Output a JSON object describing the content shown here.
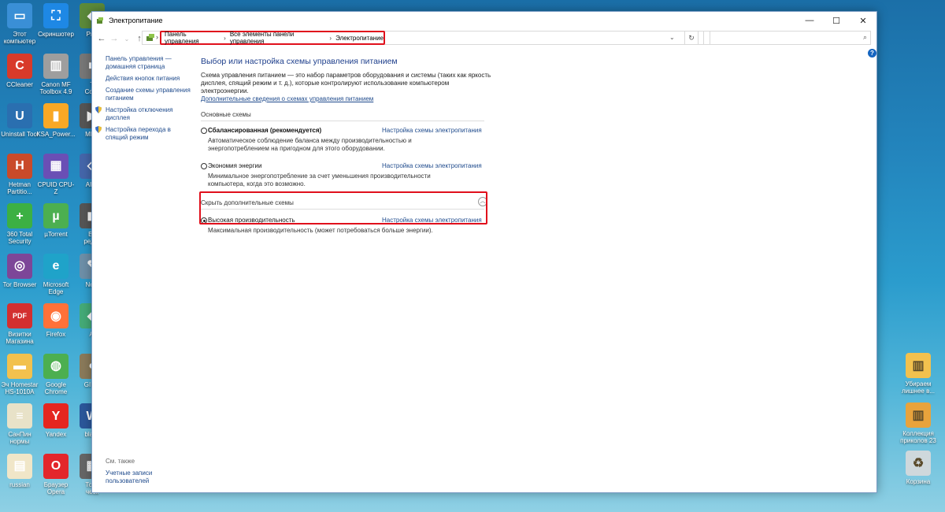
{
  "desktop": {
    "left_icons": [
      {
        "label": "Этот\nкомпьютер",
        "icon": "computer-icon",
        "color": "#3a8fd6",
        "glyph": "▭"
      },
      {
        "label": "CCleaner",
        "icon": "ccleaner-icon",
        "color": "#d83a2a",
        "glyph": "C"
      },
      {
        "label": "Uninstall Tool",
        "icon": "uninstall-tool-icon",
        "color": "#2a6fb0",
        "glyph": "U"
      },
      {
        "label": "Hetman\nPartitio...",
        "icon": "hetman-icon",
        "color": "#c94a2a",
        "glyph": "H"
      },
      {
        "label": "360 Total\nSecurity",
        "icon": "360-security-icon",
        "color": "#3cb043",
        "glyph": "+"
      },
      {
        "label": "Tor Browser",
        "icon": "tor-icon",
        "color": "#7d4698",
        "glyph": "◎"
      },
      {
        "label": "Визитки\nМагазина",
        "icon": "pdf-icon",
        "color": "#d32f2f",
        "glyph": "PDF"
      },
      {
        "label": "Эч Homestar\nHS-1010A",
        "icon": "folder-icon",
        "color": "#f2c14e",
        "glyph": "▬"
      },
      {
        "label": "СанПин\nнормы",
        "icon": "document-icon",
        "color": "#e8e2c8",
        "glyph": "≡"
      },
      {
        "label": "russian",
        "icon": "file-icon",
        "color": "#f0e6c8",
        "glyph": "▤"
      }
    ],
    "second_icons": [
      {
        "label": "Скриншотер",
        "icon": "screenshoter-icon",
        "color": "#1e88e5",
        "glyph": "⛶"
      },
      {
        "label": "Canon MF\nToolbox 4.9",
        "icon": "canon-icon",
        "color": "#9e9e9e",
        "glyph": "▥"
      },
      {
        "label": "KSA_Power...",
        "icon": "ksa-icon",
        "color": "#f9a825",
        "glyph": "▮"
      },
      {
        "label": "CPUID CPU-Z",
        "icon": "cpuz-icon",
        "color": "#6a4fb5",
        "glyph": "▦"
      },
      {
        "label": "µTorrent",
        "icon": "utorrent-icon",
        "color": "#4caf50",
        "glyph": "µ"
      },
      {
        "label": "Microsoft\nEdge",
        "icon": "edge-icon",
        "color": "#1fa3c9",
        "glyph": "e"
      },
      {
        "label": "Firefox",
        "icon": "firefox-icon",
        "color": "#ff7139",
        "glyph": "◉"
      },
      {
        "label": "Google\nChrome",
        "icon": "chrome-icon",
        "color": "#4caf50",
        "glyph": "◍"
      },
      {
        "label": "Yandex",
        "icon": "yandex-icon",
        "color": "#e52620",
        "glyph": "Y"
      },
      {
        "label": "Браузер\nOpera",
        "icon": "opera-icon",
        "color": "#e3262c",
        "glyph": "O"
      }
    ],
    "third_icons": [
      {
        "label": "Prot",
        "icon": "app-icon",
        "color": "#5c8a3a",
        "glyph": "◆"
      },
      {
        "label": "T\nComi",
        "icon": "app-icon",
        "color": "#777",
        "glyph": "■"
      },
      {
        "label": "MPC",
        "icon": "mpc-icon",
        "color": "#555",
        "glyph": "▶"
      },
      {
        "label": "AIIM",
        "icon": "app-icon",
        "color": "#4466aa",
        "glyph": "◇"
      },
      {
        "label": "Ва\nредак",
        "icon": "app-icon",
        "color": "#555",
        "glyph": "◼"
      },
      {
        "label": "Note",
        "icon": "notepad-icon",
        "color": "#6d8fa8",
        "glyph": "✎"
      },
      {
        "label": "Al",
        "icon": "app-icon",
        "color": "#4a7",
        "glyph": "◆"
      },
      {
        "label": "GIMP",
        "icon": "gimp-icon",
        "color": "#8a7a5a",
        "glyph": "◐"
      },
      {
        "label": "blank",
        "icon": "word-icon",
        "color": "#2b579a",
        "glyph": "W"
      },
      {
        "label": "Това\nческ",
        "icon": "app-icon",
        "color": "#666",
        "glyph": "▦"
      }
    ],
    "right_icons": [
      {
        "label": "Убираем\nлишнее в...",
        "icon": "folder-archive-icon",
        "color": "#f2c14e",
        "glyph": "▥"
      },
      {
        "label": "Коллекция\nприколов 23",
        "icon": "folder-archive-icon",
        "color": "#e8a33c",
        "glyph": "▥"
      },
      {
        "label": "Корзина",
        "icon": "recycle-bin-icon",
        "color": "#cfd8dc",
        "glyph": "♻"
      }
    ]
  },
  "window": {
    "title": "Электропитание",
    "controls": {
      "minimize": "—",
      "maximize": "☐",
      "close": "✕"
    },
    "breadcrumbs": [
      "Панель управления",
      "Все элементы панели управления",
      "Электропитание"
    ],
    "breadcrumb_sep": "›",
    "search_placeholder": "",
    "help": "?"
  },
  "leftnav": {
    "items": [
      "Панель управления —\nдомашняя страница",
      "Действия кнопок питания",
      "Создание схемы управления\nпитанием",
      "Настройка отключения\nдисплея",
      "Настройка перехода в\nспящий режим"
    ],
    "see_also_label": "См. также",
    "see_also_link": "Учетные записи\nпользователей"
  },
  "main": {
    "title": "Выбор или настройка схемы управления питанием",
    "description": "Схема управления питанием — это набор параметров оборудования и системы (таких как яркость дисплея, спящий режим и т. д.), которые контролируют использование компьютером электроэнергии.",
    "details_link": "Дополнительные сведения о схемах управления питанием",
    "basic_group": "Основные схемы",
    "plans": [
      {
        "name": "Сбалансированная (рекомендуется)",
        "bold": true,
        "checked": false,
        "link": "Настройка схемы электропитания",
        "desc": "Автоматическое соблюдение баланса между производительностью и энергопотреблением на пригодном для этого оборудовании."
      },
      {
        "name": "Экономия энергии",
        "bold": false,
        "checked": false,
        "link": "Настройка схемы электропитания",
        "desc": "Минимальное энергопотребление за счет уменьшения производительности компьютера, когда это возможно."
      }
    ],
    "hide_extra_label": "Скрыть дополнительные схемы",
    "extra_plans": [
      {
        "name": "Высокая производительность",
        "bold": false,
        "checked": true,
        "link": "Настройка схемы электропитания",
        "desc": "Максимальная производительность (может потребоваться больше энергии)."
      }
    ]
  }
}
